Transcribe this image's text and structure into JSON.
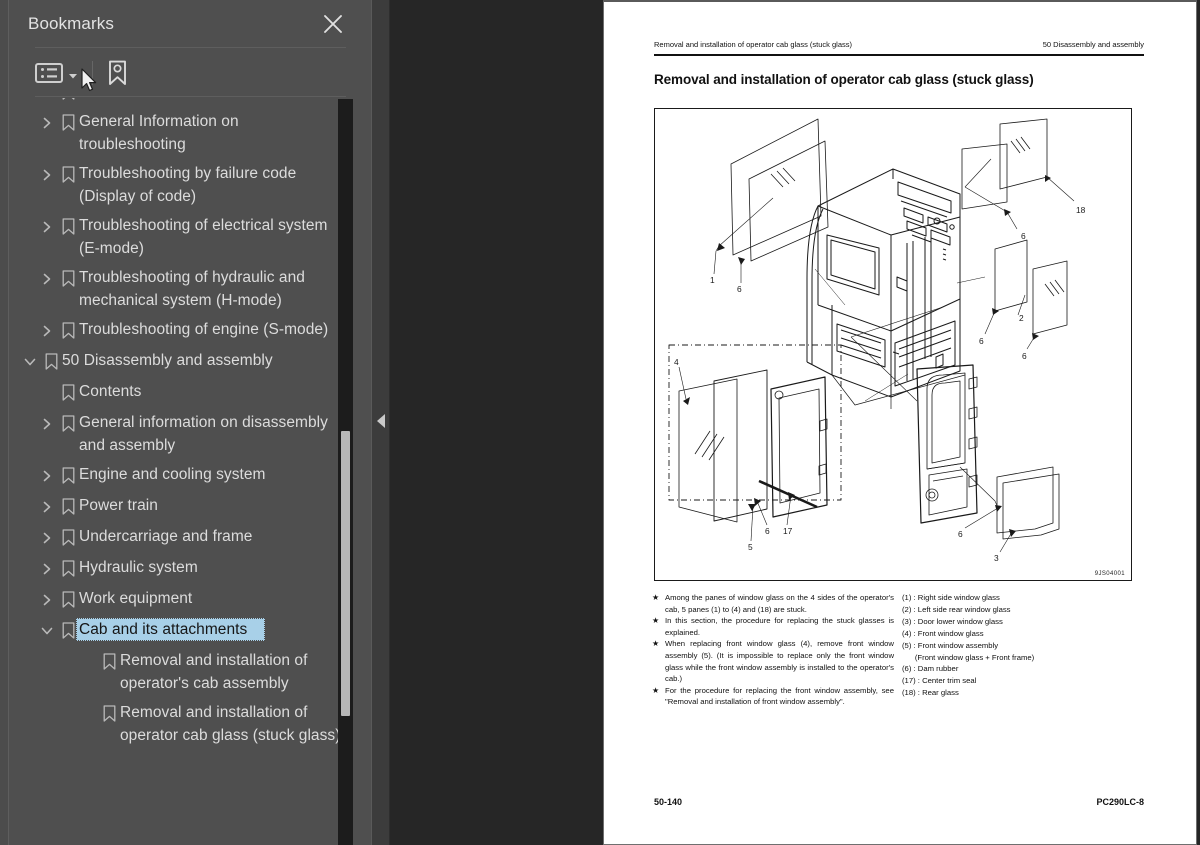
{
  "panel": {
    "title": "Bookmarks",
    "close_label": "×",
    "toolbar": {
      "options_label": "Bookmark options",
      "new_bookmark_label": "New bookmark"
    }
  },
  "bookmarks": [
    {
      "label": "Contents",
      "level": 1,
      "twisty": "none",
      "selected": false
    },
    {
      "label": "General Information on troubleshooting",
      "level": 1,
      "twisty": "collapsed",
      "selected": false
    },
    {
      "label": "Troubleshooting by failure code (Display of code)",
      "level": 1,
      "twisty": "collapsed",
      "selected": false
    },
    {
      "label": "Troubleshooting of electrical system (E-mode)",
      "level": 1,
      "twisty": "collapsed",
      "selected": false
    },
    {
      "label": "Troubleshooting of hydraulic and mechanical system (H-mode)",
      "level": 1,
      "twisty": "collapsed",
      "selected": false
    },
    {
      "label": "Troubleshooting of engine (S-mode)",
      "level": 1,
      "twisty": "collapsed",
      "selected": false
    },
    {
      "label": "50 Disassembly and assembly",
      "level": 0,
      "twisty": "expanded",
      "selected": false
    },
    {
      "label": "Contents",
      "level": 1,
      "twisty": "none",
      "selected": false
    },
    {
      "label": "General information on disassembly and assembly",
      "level": 1,
      "twisty": "collapsed",
      "selected": false
    },
    {
      "label": "Engine and cooling system",
      "level": 1,
      "twisty": "collapsed",
      "selected": false
    },
    {
      "label": "Power train",
      "level": 1,
      "twisty": "collapsed",
      "selected": false
    },
    {
      "label": "Undercarriage and frame",
      "level": 1,
      "twisty": "collapsed",
      "selected": false
    },
    {
      "label": "Hydraulic system",
      "level": 1,
      "twisty": "collapsed",
      "selected": false
    },
    {
      "label": "Work equipment",
      "level": 1,
      "twisty": "collapsed",
      "selected": false
    },
    {
      "label": "Cab and its attachments",
      "level": 1,
      "twisty": "expanded",
      "selected": true
    },
    {
      "label": "Removal and installation of operator's cab assembly",
      "level": 2,
      "twisty": "none",
      "selected": false
    },
    {
      "label": "Removal and installation of operator cab glass (stuck glass)",
      "level": 2,
      "twisty": "none",
      "selected": false
    }
  ],
  "document": {
    "running_head_left": "Removal and installation of operator cab glass (stuck glass)",
    "running_head_right": "50 Disassembly and assembly",
    "heading": "Removal and installation of operator cab glass (stuck glass)",
    "figure_id": "9JS04001",
    "figure_callouts": [
      "1",
      "6",
      "6",
      "18",
      "2",
      "6",
      "4",
      "6",
      "17",
      "5",
      "6",
      "3"
    ],
    "notes": [
      "Among the panes of window glass on the 4 sides of the operator's cab, 5 panes (1) to (4) and (18) are stuck.",
      "In this section, the procedure for replacing the stuck glasses is explained.",
      "When replacing front window glass (4), remove front window assembly (5). (It is impossible to replace only the front window glass while the front window assembly is installed to the operator's cab.)",
      "For the procedure for replacing the front window assembly, see \"Removal and installation of front window assembly\"."
    ],
    "legend": [
      "(1) : Right side window glass",
      "(2) : Left side rear window glass",
      "(3) : Door lower window glass",
      "(4) : Front window glass",
      "(5) : Front window assembly",
      "      (Front window glass + Front frame)",
      "(6) : Dam rubber",
      "(17) : Center trim seal",
      "(18) : Rear glass"
    ],
    "footer_left": "50-140",
    "footer_right": "PC290LC-8"
  },
  "colors": {
    "panel_bg": "#4f4f4f",
    "viewer_bg": "#262626",
    "selection": "#a8d0e8",
    "page_bg": "#ffffff",
    "text": "#dcdcdc"
  }
}
